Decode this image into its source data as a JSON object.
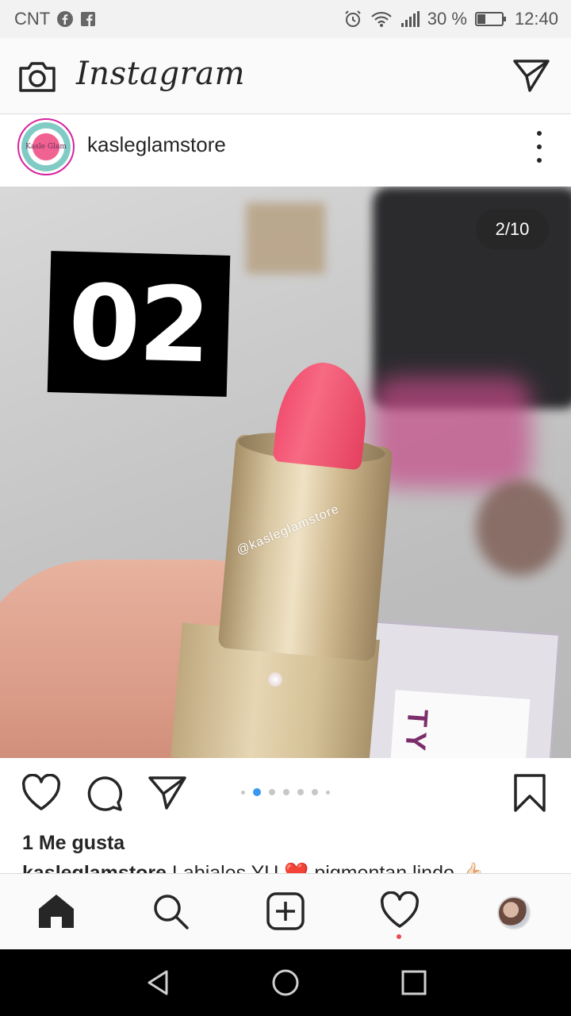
{
  "status_bar": {
    "carrier": "CNT",
    "battery": "30 %",
    "time": "12:40"
  },
  "app": {
    "title": "Instagram"
  },
  "post": {
    "username": "kasleglamstore",
    "avatar_text": "Kasle Glam",
    "image_counter": "2/10",
    "image_overlay_number": "02",
    "image_watermark": "@kasleglamstore",
    "box_text": "TY",
    "likes": "1 Me gusta",
    "caption_user": "kasleglamstore",
    "caption_text": " Labiales YU ❤️ pigmentan lindo 👍🏻"
  },
  "carousel": {
    "total_visible_dots": 7,
    "active_index": 1
  },
  "colors": {
    "accent_blue": "#3897f0",
    "notification_red": "#ed4956",
    "text": "#262626"
  },
  "icons": {
    "action_bar": [
      "heart-icon",
      "comment-icon",
      "share-icon",
      "bookmark-icon"
    ],
    "bottom_nav": [
      "home-icon",
      "search-icon",
      "new-post-icon",
      "activity-heart-icon",
      "profile-avatar"
    ],
    "system_nav": [
      "back-icon",
      "home-circle-icon",
      "recents-icon"
    ]
  }
}
